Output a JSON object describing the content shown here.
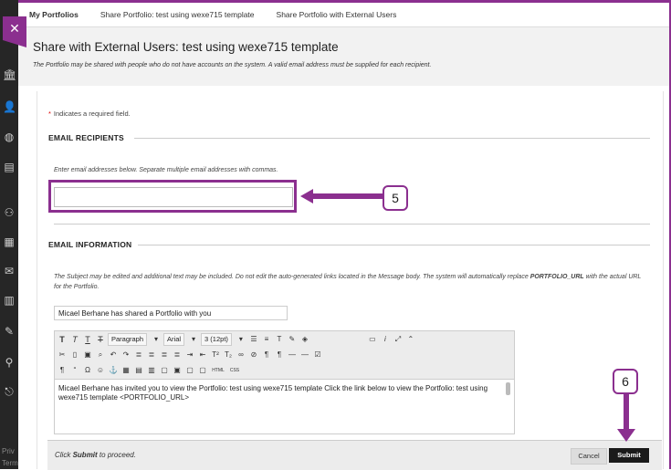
{
  "breadcrumb": {
    "items": [
      "My Portfolios",
      "Share Portfolio: test using wexe715 template",
      "Share Portfolio with External Users"
    ]
  },
  "sidebar": {
    "close_icon": "close-icon",
    "footer_lines": [
      "Priv",
      "Term"
    ]
  },
  "header": {
    "title": "Share with External Users: test using wexe715 template",
    "description": "The Portfolio may be shared with people who do not have accounts on the system. A valid email address must be supplied for each recipient."
  },
  "form": {
    "required_star": "*",
    "required_note": "Indicates a required field.",
    "recipients_section": "EMAIL RECIPIENTS",
    "recipients_hint": "Enter email addresses below. Separate multiple email addresses with commas.",
    "recipients_value": "",
    "info_section": "EMAIL INFORMATION",
    "info_hint_1": "The Subject may be edited and additional text may be included. Do not edit the auto-generated links located in the Message body. The system will automatically replace",
    "info_hint_token": "PORTFOLIO_URL",
    "info_hint_2": "with the actual URL for the Portfolio.",
    "subject_value": "Micael Berhane has shared a Portfolio with you",
    "editor": {
      "paragraph_label": "Paragraph",
      "font_label": "Arial",
      "size_label": "3 (12pt)",
      "body_text": "Micael Berhane has invited you to view the Portfolio: test using wexe715 template Click the link below to view the Portfolio: test using wexe715 template <PORTFOLIO_URL>"
    }
  },
  "footer": {
    "hint_prefix": "Click",
    "hint_bold": "Submit",
    "hint_suffix": "to proceed.",
    "cancel_label": "Cancel",
    "submit_label": "Submit"
  },
  "callouts": {
    "step_5": "5",
    "step_6": "6"
  },
  "colors": {
    "accent": "#8b2f8f",
    "sidebar_bg": "#262626",
    "submit_bg": "#1a1a1a"
  }
}
